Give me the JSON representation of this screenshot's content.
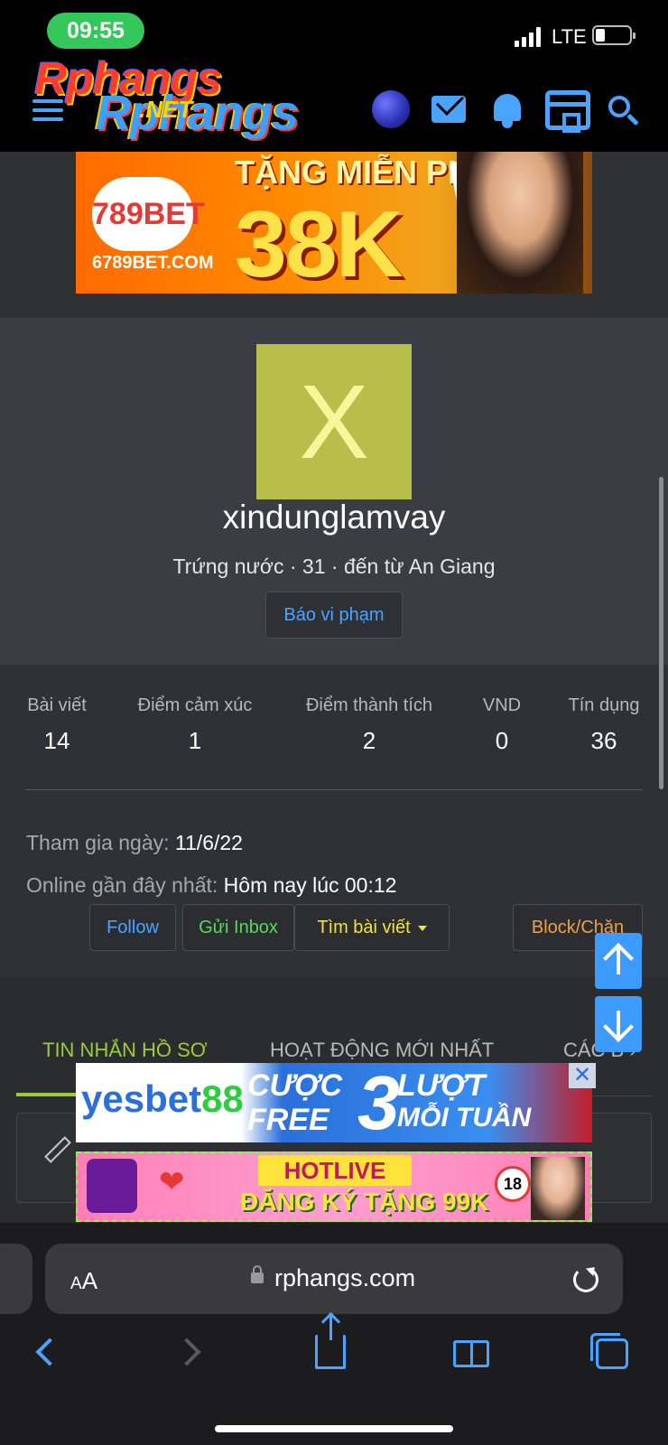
{
  "status_bar": {
    "time": "09:55",
    "network": "LTE",
    "battery_level": 0.2
  },
  "header": {
    "logo_text_1": "Rphangs",
    "logo_text_2": "Rphangs",
    "logo_net": ".NET",
    "icons": [
      "menu-icon",
      "globe-icon",
      "mail-icon",
      "bell-icon",
      "store-icon",
      "search-icon"
    ]
  },
  "ad_top": {
    "brand": "789BET",
    "site": "6789BET.COM",
    "line1": "TẶNG MIỄN PHÍ",
    "line2": "38K"
  },
  "profile": {
    "avatar_letter": "X",
    "username": "xindunglamvay",
    "info": "Trứng nước · 31 · đến từ An Giang",
    "report_label": "Báo vi phạm"
  },
  "stats": [
    {
      "label": "Bài viết",
      "value": "14"
    },
    {
      "label": "Điểm cảm xúc",
      "value": "1"
    },
    {
      "label": "Điểm thành tích",
      "value": "2"
    },
    {
      "label": "VND",
      "value": "0"
    },
    {
      "label": "Tín dụng",
      "value": "36"
    }
  ],
  "joined": {
    "label": "Tham gia ngày:",
    "value": "11/6/22"
  },
  "online": {
    "label": "Online gần đây nhất:",
    "value": "Hôm nay lúc 00:12"
  },
  "actions": {
    "follow": "Follow",
    "inbox": "Gửi Inbox",
    "find_posts": "Tìm bài viết",
    "block": "Block/Chặn"
  },
  "tabs": [
    {
      "label": "TIN NHẮN HỒ SƠ",
      "active": true
    },
    {
      "label": "HOẠT ĐỘNG MỚI NHẤT",
      "active": false
    },
    {
      "label": "CÁC B",
      "active": false
    }
  ],
  "ad_mid": {
    "brand": "yesbet",
    "brand_num": "88",
    "line1": "CƯỢC",
    "line2": "FREE",
    "big": "3",
    "line3": "LƯỢT",
    "line4": "MỖI TUẦN",
    "close": "✕"
  },
  "ad_bot": {
    "badge": "HOTLIVE",
    "line": "ĐĂNG KÝ TẶNG 99K",
    "age": "18"
  },
  "browser": {
    "text_size_small": "A",
    "text_size_big": "A",
    "url": "rphangs.com"
  },
  "colors": {
    "accent": "#4aa3ff",
    "tab_active": "#9ccd36",
    "avatar_bg": "#b7bf4a",
    "page_bg": "#2e3034"
  }
}
